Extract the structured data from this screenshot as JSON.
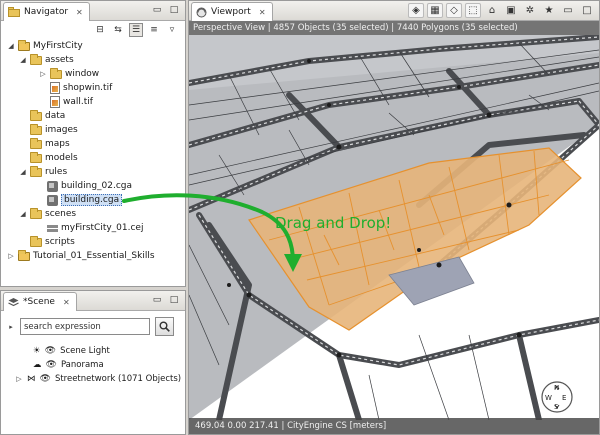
{
  "navigator": {
    "tab_label": "Navigator",
    "tree": [
      {
        "label": "MyFirstCity",
        "type": "project",
        "expanded": true
      },
      {
        "label": "assets",
        "type": "folder",
        "expanded": true
      },
      {
        "label": "window",
        "type": "folder",
        "expanded": false
      },
      {
        "label": "shopwin.tif",
        "type": "image"
      },
      {
        "label": "wall.tif",
        "type": "image"
      },
      {
        "label": "data",
        "type": "folder"
      },
      {
        "label": "images",
        "type": "folder"
      },
      {
        "label": "maps",
        "type": "folder"
      },
      {
        "label": "models",
        "type": "folder"
      },
      {
        "label": "rules",
        "type": "folder",
        "expanded": true
      },
      {
        "label": "building_02.cga",
        "type": "cga"
      },
      {
        "label": "building.cga",
        "type": "cga",
        "selected": true
      },
      {
        "label": "scenes",
        "type": "folder",
        "expanded": true
      },
      {
        "label": "myFirstCity_01.cej",
        "type": "cej"
      },
      {
        "label": "scripts",
        "type": "folder"
      },
      {
        "label": "Tutorial_01_Essential_Skills",
        "type": "project",
        "expanded": false
      }
    ]
  },
  "scene_panel": {
    "tab_label": "*Scene",
    "search_placeholder": "search expression",
    "layers": [
      {
        "label": "Scene Light",
        "icon": "sun-icon"
      },
      {
        "label": "Panorama",
        "icon": "cloud-icon"
      },
      {
        "label": "Streetnetwork (1071 Objects)",
        "icon": "network-icon",
        "expandable": true
      }
    ]
  },
  "viewport": {
    "tab_label": "Viewport",
    "info": "Perspective View   |   4857 Objects   (35 selected)   |   7440 Polygons   (35 selected)",
    "status": "469.04  0.00  217.41    |    CityEngine CS [meters]",
    "compass_letters": [
      "N",
      "E",
      "S",
      "W"
    ]
  },
  "annotation": {
    "text": "Drag and Drop!",
    "color": "#1fae2e"
  },
  "colors": {
    "selection_fill": "#e7b57a",
    "selection_stroke": "#e6912e",
    "street": "#8e9094",
    "block": "#c3c5c9"
  }
}
